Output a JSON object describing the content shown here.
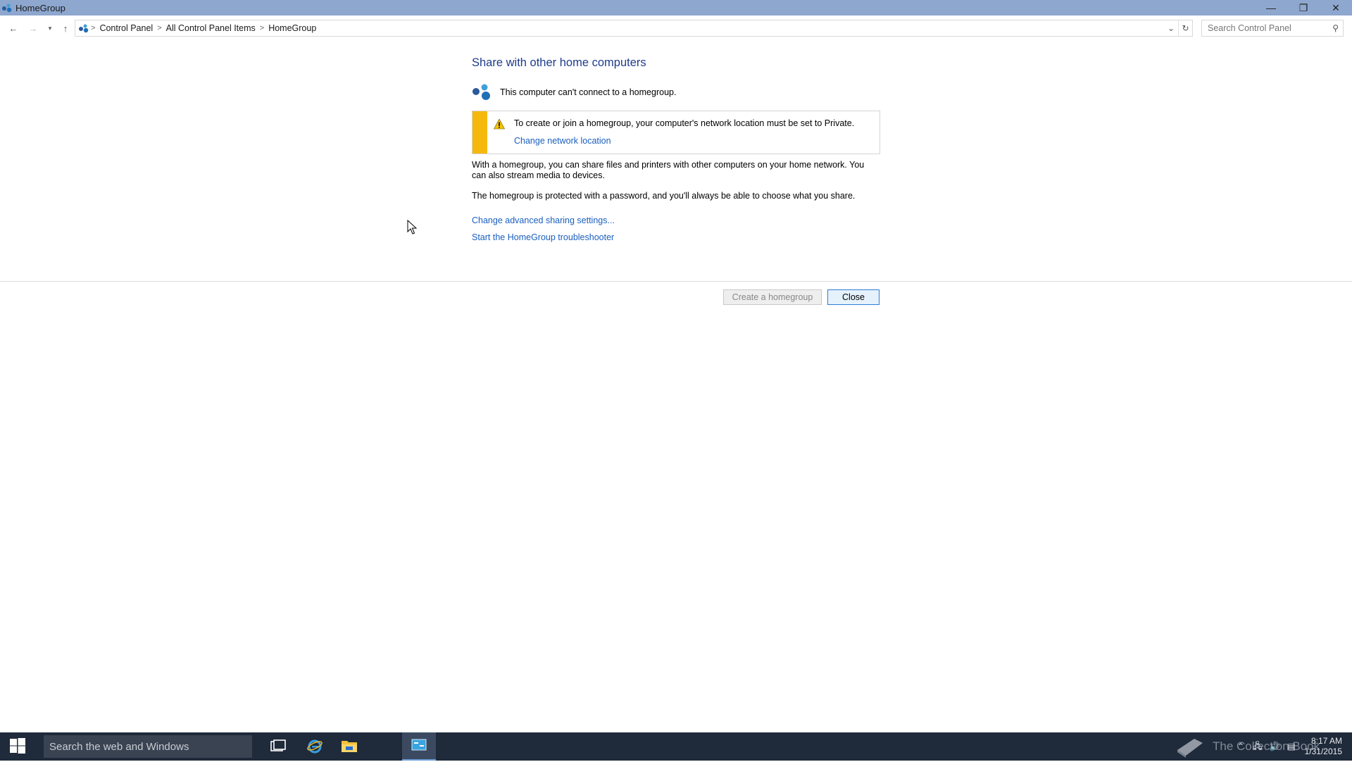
{
  "window": {
    "title": "HomeGroup",
    "controls": {
      "minimize": "—",
      "restore": "❐",
      "close": "✕"
    }
  },
  "address": {
    "crumbs": [
      "Control Panel",
      "All Control Panel Items",
      "HomeGroup"
    ],
    "search_placeholder": "Search Control Panel"
  },
  "main": {
    "title": "Share with other home computers",
    "status": "This computer can't connect to a homegroup.",
    "warning": {
      "text": "To create or join a homegroup, your computer's network location must be set to Private.",
      "link": "Change network location"
    },
    "description": "With a homegroup, you can share files and printers with other computers on your home network. You can also stream media to devices.",
    "password_note": "The homegroup is protected with a password, and you'll always be able to choose what you share.",
    "links": [
      "Change advanced sharing settings...",
      "Start the HomeGroup troubleshooter"
    ],
    "buttons": {
      "create": "Create a homegroup",
      "close": "Close"
    }
  },
  "taskbar": {
    "search_placeholder": "Search the web and Windows",
    "watermark": "The Collection Book",
    "time": "8:17 AM",
    "date": "1/31/2015"
  },
  "colors": {
    "titlebar": "#8ea7cf",
    "link": "#1a5fbf",
    "heading": "#1e3c8c",
    "warning_stripe": "#f5b90d",
    "taskbar": "#1f2a3a"
  }
}
